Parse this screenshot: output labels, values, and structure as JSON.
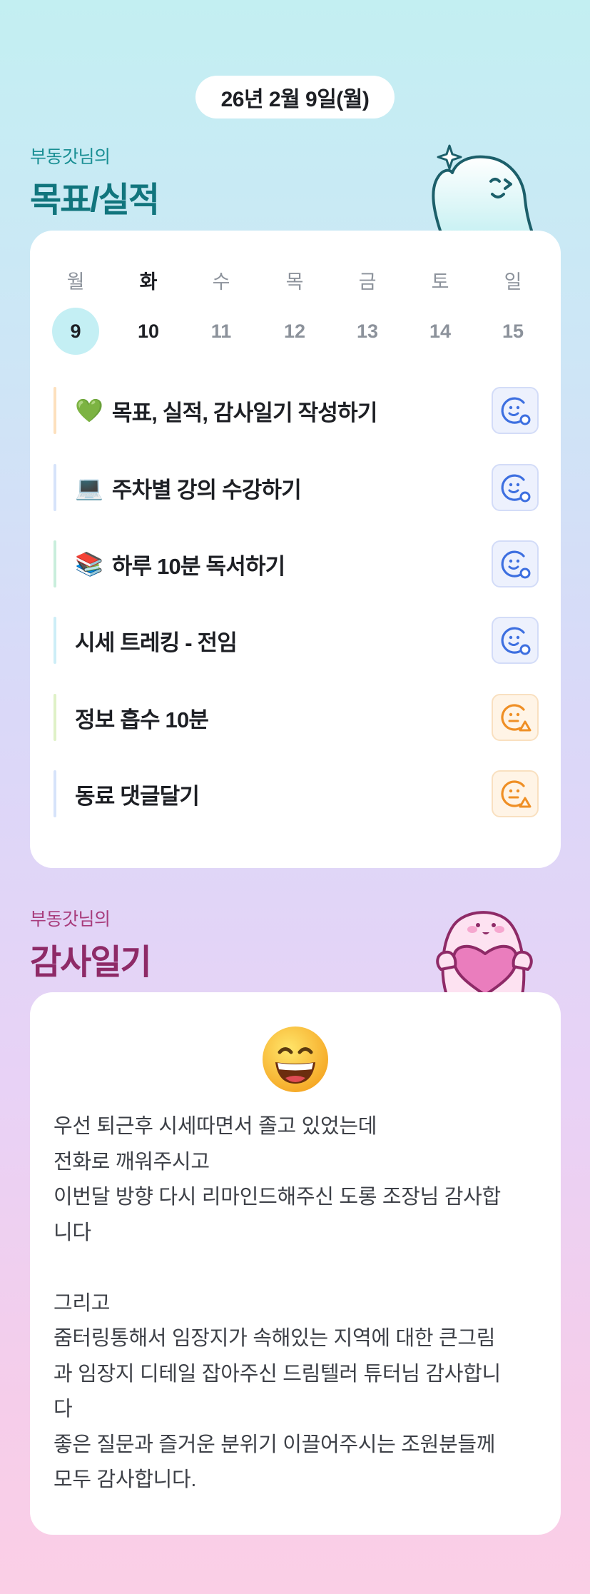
{
  "header": {
    "date": "26년 2월 9일(월)"
  },
  "goals": {
    "subtitle": "부동갓님의",
    "title": "목표/실적",
    "weekdays": [
      "월",
      "화",
      "수",
      "목",
      "금",
      "토",
      "일"
    ],
    "dates": [
      "9",
      "10",
      "11",
      "12",
      "13",
      "14",
      "15"
    ],
    "selected_index": 0,
    "tasks": [
      {
        "emoji": "💚",
        "label": "목표, 실적, 감사일기 작성하기",
        "status": "done",
        "bar_color": "#fde0bd"
      },
      {
        "emoji": "💻",
        "label": "주차별 강의 수강하기",
        "status": "done",
        "bar_color": "#d6e3fa"
      },
      {
        "emoji": "📚",
        "label": "하루 10분 독서하기",
        "status": "done",
        "bar_color": "#c9eedc"
      },
      {
        "emoji": "",
        "label": "시세 트레킹 - 전임",
        "status": "done",
        "bar_color": "#cdeef7"
      },
      {
        "emoji": "",
        "label": "정보 흡수 10분",
        "status": "warn",
        "bar_color": "#dff1c7"
      },
      {
        "emoji": "",
        "label": "동료 댓글달기",
        "status": "warn",
        "bar_color": "#d6e3fa"
      }
    ]
  },
  "gratitude": {
    "subtitle": "부동갓님의",
    "title": "감사일기",
    "mood_icon": "grinning-face-icon",
    "text": "우선 퇴근후 시세따면서 졸고 있었는데\n전화로 깨워주시고\n이번달 방향 다시 리마인드해주신 도롱 조장님 감사합\n니다\n\n그리고\n줌터링통해서 임장지가 속해있는 지역에 대한 큰그림\n과 임장지 디테일 잡아주신 드림텔러 튜터님 감사합니\n다\n좋은 질문과 즐거운 분위기 이끌어주시는 조원분들께\n모두 감사합니다."
  },
  "colors": {
    "done_icon": "#3d6fe0",
    "warn_icon": "#ef8f25",
    "goal_title": "#11757d",
    "gratitude_title": "#8e2a67"
  }
}
